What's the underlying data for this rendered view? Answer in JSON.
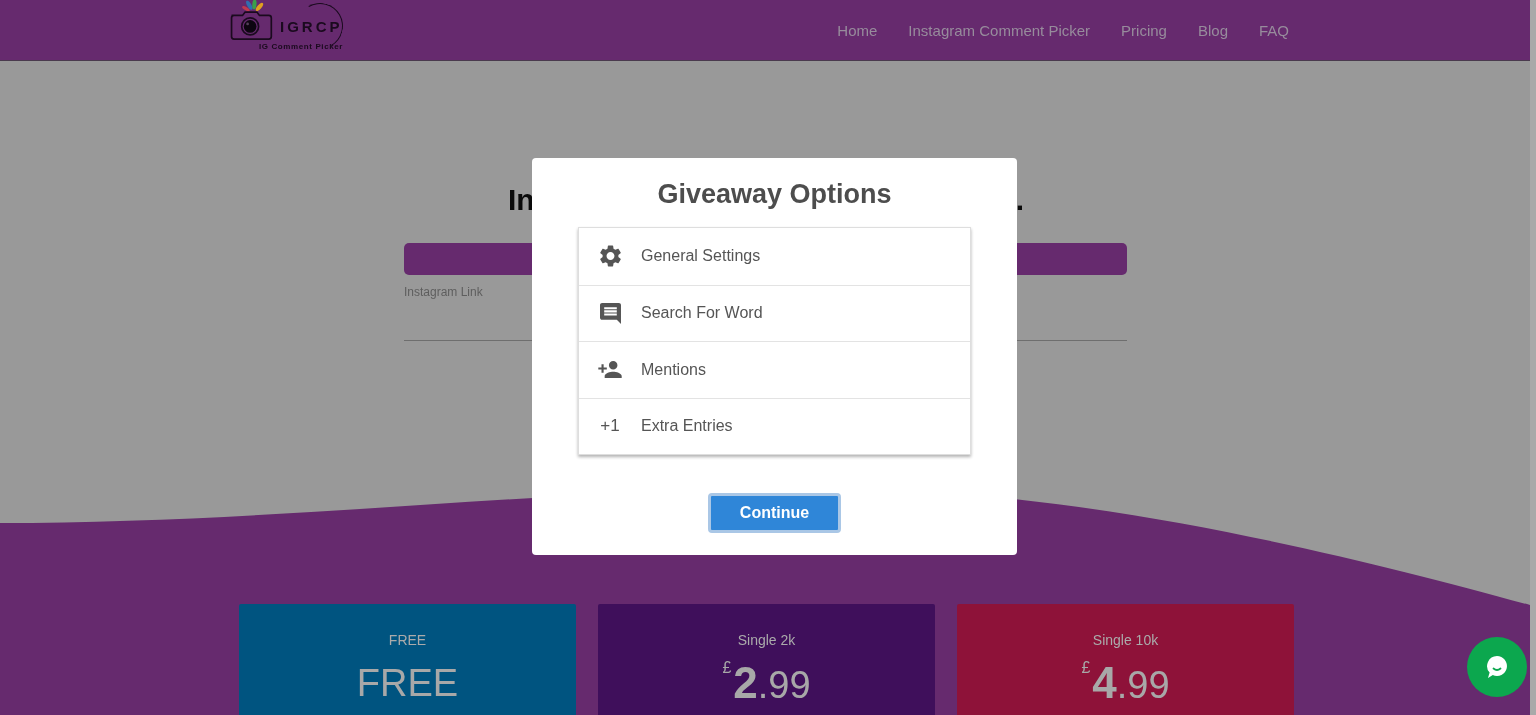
{
  "header": {
    "logo": {
      "title": "IGRCP",
      "subtitle": "IG Comment Picker"
    },
    "nav": [
      "Home",
      "Instagram Comment Picker",
      "Pricing",
      "Blog",
      "FAQ"
    ]
  },
  "hero": {
    "heading_start": "In",
    "heading_end": ".",
    "link_label": "Instagram Link"
  },
  "modal": {
    "title": "Giveaway Options",
    "options": [
      {
        "kind": "settings",
        "label": "General Settings"
      },
      {
        "kind": "word",
        "label": "Search For Word"
      },
      {
        "kind": "mentions",
        "label": "Mentions"
      },
      {
        "kind": "entries",
        "marker": "+1",
        "label": "Extra Entries"
      }
    ],
    "button": {
      "label": "Continue",
      "focused": true
    }
  },
  "pricing": [
    {
      "title": "FREE",
      "price": "FREE",
      "color": "#005480"
    },
    {
      "title": "Single 2k",
      "price": "$^{£}$**2**.99",
      "color": "#3f0f5b"
    },
    {
      "title": "Single 10k",
      "price": "$^{£}$**4**.99",
      "color": "#8e1239"
    }
  ]
}
